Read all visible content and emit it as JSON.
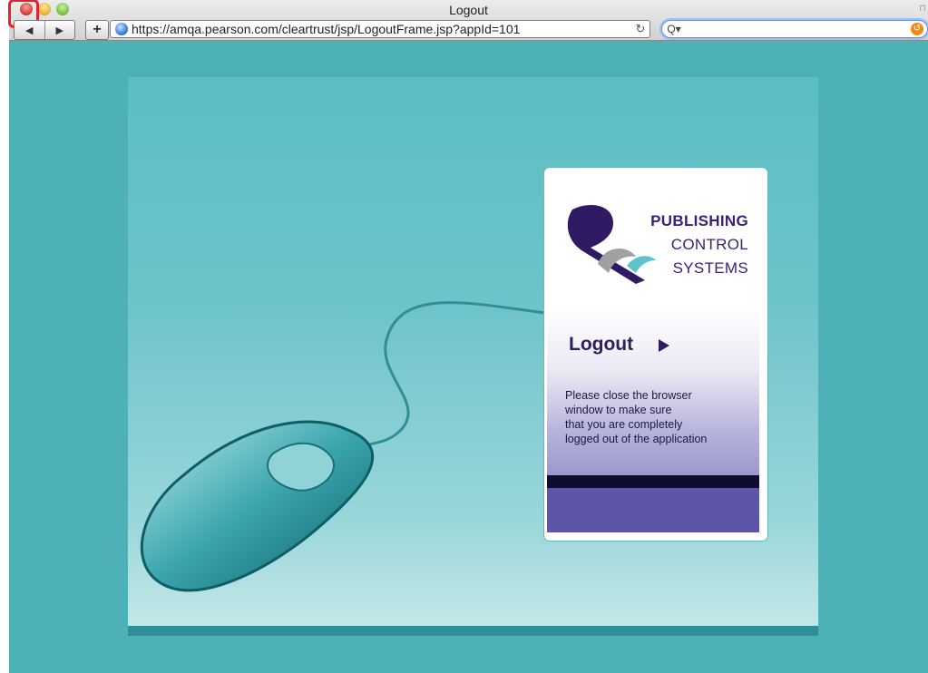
{
  "window": {
    "title": "Logout"
  },
  "toolbar": {
    "back_glyph": "◀",
    "forward_glyph": "▶",
    "add_glyph": "+",
    "url": "https://amqa.pearson.com/cleartrust/jsp/LogoutFrame.jsp?appId=101",
    "reload_glyph": "↻",
    "search_placeholder": "",
    "search_glyph": "Q▾"
  },
  "logo": {
    "line1": "PUBLISHING",
    "line2": "CONTROL",
    "line3": "SYSTEMS"
  },
  "card": {
    "heading": "Logout",
    "message": "Please close the browser\nwindow to make sure\nthat you are completely\nlogged out of the application"
  },
  "colors": {
    "background": "#4fb1b8",
    "brand_purple": "#3b1f73",
    "highlight": "#e12230"
  },
  "icons": {
    "close": "close-window-icon",
    "minimize": "minimize-window-icon",
    "maximize": "zoom-window-icon",
    "globe": "globe-icon",
    "reload": "reload-icon",
    "search": "search-icon",
    "snapback": "snapback-icon",
    "play": "arrow-right-icon"
  }
}
